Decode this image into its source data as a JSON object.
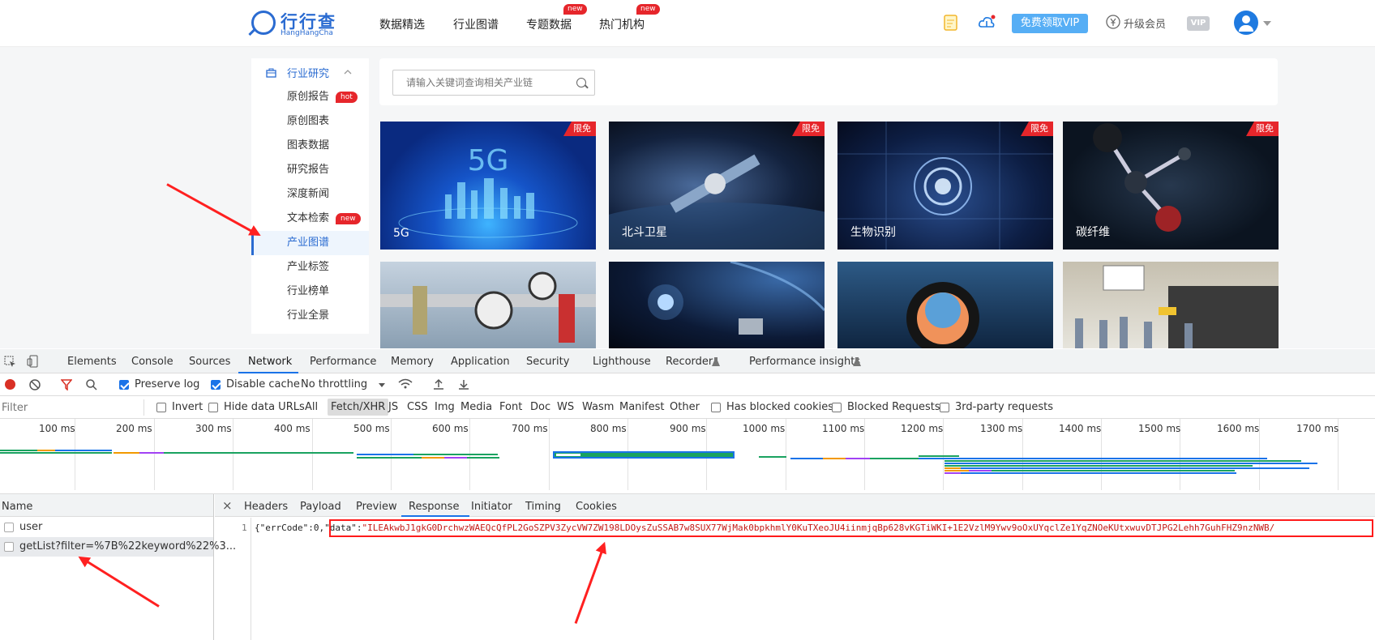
{
  "site": {
    "logo": {
      "cn": "行行查",
      "en": "HangHangCha"
    },
    "nav": [
      {
        "label": "数据精选"
      },
      {
        "label": "行业图谱"
      },
      {
        "label": "专题数据",
        "badge": "new"
      },
      {
        "label": "热门机构",
        "badge": "new"
      }
    ],
    "vip_button": "免费领取VIP",
    "upgrade": "升级会员",
    "vip_badge": "VIP",
    "side": {
      "head": "行业研究",
      "items": [
        {
          "label": "原创报告",
          "badge": "hot"
        },
        {
          "label": "原创图表"
        },
        {
          "label": "图表数据"
        },
        {
          "label": "研究报告"
        },
        {
          "label": "深度新闻"
        },
        {
          "label": "文本检索",
          "badge": "new"
        },
        {
          "label": "产业图谱",
          "active": true
        },
        {
          "label": "产业标签"
        },
        {
          "label": "行业榜单"
        },
        {
          "label": "行业全景"
        }
      ]
    },
    "search_placeholder": "请输入关键词查询相关产业链",
    "cards": [
      {
        "title": "5G",
        "badge": "限免"
      },
      {
        "title": "北斗卫星",
        "badge": "限免"
      },
      {
        "title": "生物识别",
        "badge": "限免"
      },
      {
        "title": "碳纤维",
        "badge": "限免"
      },
      {
        "title": ""
      },
      {
        "title": ""
      },
      {
        "title": ""
      },
      {
        "title": ""
      }
    ]
  },
  "devtools": {
    "tabs": [
      "Elements",
      "Console",
      "Sources",
      "Network",
      "Performance",
      "Memory",
      "Application",
      "Security",
      "Lighthouse",
      "Recorder",
      "Performance insights"
    ],
    "active_tab": "Network",
    "toolbar": {
      "preserve_log": "Preserve log",
      "disable_cache": "Disable cache",
      "throttling": "No throttling"
    },
    "filter": {
      "placeholder": "Filter",
      "invert": "Invert",
      "hide_data_urls": "Hide data URLs",
      "types": [
        "All",
        "Fetch/XHR",
        "JS",
        "CSS",
        "Img",
        "Media",
        "Font",
        "Doc",
        "WS",
        "Wasm",
        "Manifest",
        "Other"
      ],
      "active_type": "Fetch/XHR",
      "has_blocked_cookies": "Has blocked cookies",
      "blocked_requests": "Blocked Requests",
      "third_party": "3rd-party requests"
    },
    "timeline_ticks": [
      "100 ms",
      "200 ms",
      "300 ms",
      "400 ms",
      "500 ms",
      "600 ms",
      "700 ms",
      "800 ms",
      "900 ms",
      "1000 ms",
      "1100 ms",
      "1200 ms",
      "1300 ms",
      "1400 ms",
      "1500 ms",
      "1600 ms",
      "1700 ms"
    ],
    "name_header": "Name",
    "requests": [
      "user",
      "getList?filter=%7B%22keyword%22%3..."
    ],
    "detail_tabs": [
      "Headers",
      "Payload",
      "Preview",
      "Response",
      "Initiator",
      "Timing",
      "Cookies"
    ],
    "active_detail_tab": "Response",
    "response": {
      "line_no": "1",
      "prefix": "{\"errCode\":0,",
      "key": "\"data\"",
      "colon": ":",
      "value": "\"ILEAkwbJ1gkG0DrchwzWAEQcQfPL2GoSZPV3ZycVW7ZW198LDOysZuSSAB7w8SUX77WjMak0bpkhmlY0KuTXeoJU4iinmjqBp628vKGTiWKI+1E2VzlM9Ywv9oOxUYqclZe1YqZNOeKUtxwuvDTJPG2Lehh7GuhFHZ9nzNWB/"
    }
  }
}
